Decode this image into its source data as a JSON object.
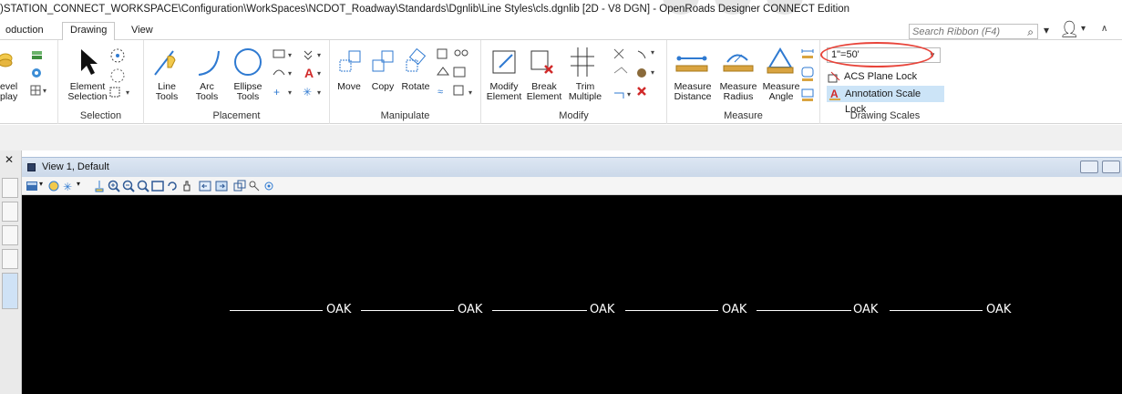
{
  "window": {
    "title": ")STATION_CONNECT_WORKSPACE\\Configuration\\WorkSpaces\\NCDOT_Roadway\\Standards\\Dgnlib\\Line Styles\\cls.dgnlib [2D - V8 DGN] - OpenRoads Designer CONNECT Edition"
  },
  "tabs": [
    {
      "label": "oduction"
    },
    {
      "label": "Drawing"
    },
    {
      "label": "View"
    }
  ],
  "search": {
    "placeholder": "Search Ribbon (F4)"
  },
  "ribbon": {
    "groups": {
      "selection": "Selection",
      "placement": "Placement",
      "manipulate": "Manipulate",
      "modify": "Modify",
      "measure": "Measure",
      "drawing_scales": "Drawing Scales"
    },
    "buttons": {
      "level_display": "evel\nplay",
      "element_selection": "Element\nSelection",
      "line_tools": "Line\nTools",
      "arc_tools": "Arc\nTools",
      "ellipse_tools": "Ellipse\nTools",
      "move": "Move",
      "copy": "Copy",
      "rotate": "Rotate",
      "modify_element": "Modify\nElement",
      "break_element": "Break\nElement",
      "trim_multiple": "Trim\nMultiple",
      "measure_distance": "Measure\nDistance",
      "measure_radius": "Measure\nRadius",
      "measure_angle": "Measure\nAngle"
    },
    "drawing_scales": {
      "scale_value": "1\"=50'",
      "acs_plane_lock": "ACS Plane Lock",
      "annotation_scale_lock": "Annotation Scale Lock"
    }
  },
  "view": {
    "title": "View 1, Default",
    "line_labels": [
      "OAK",
      "OAK",
      "OAK",
      "OAK",
      "OAK",
      "OAK"
    ]
  },
  "colors": {
    "accent_highlight": "#cce4f7",
    "annotation_oval": "#e8443a",
    "canvas_bg": "#000000",
    "line_color": "#ffffff"
  }
}
